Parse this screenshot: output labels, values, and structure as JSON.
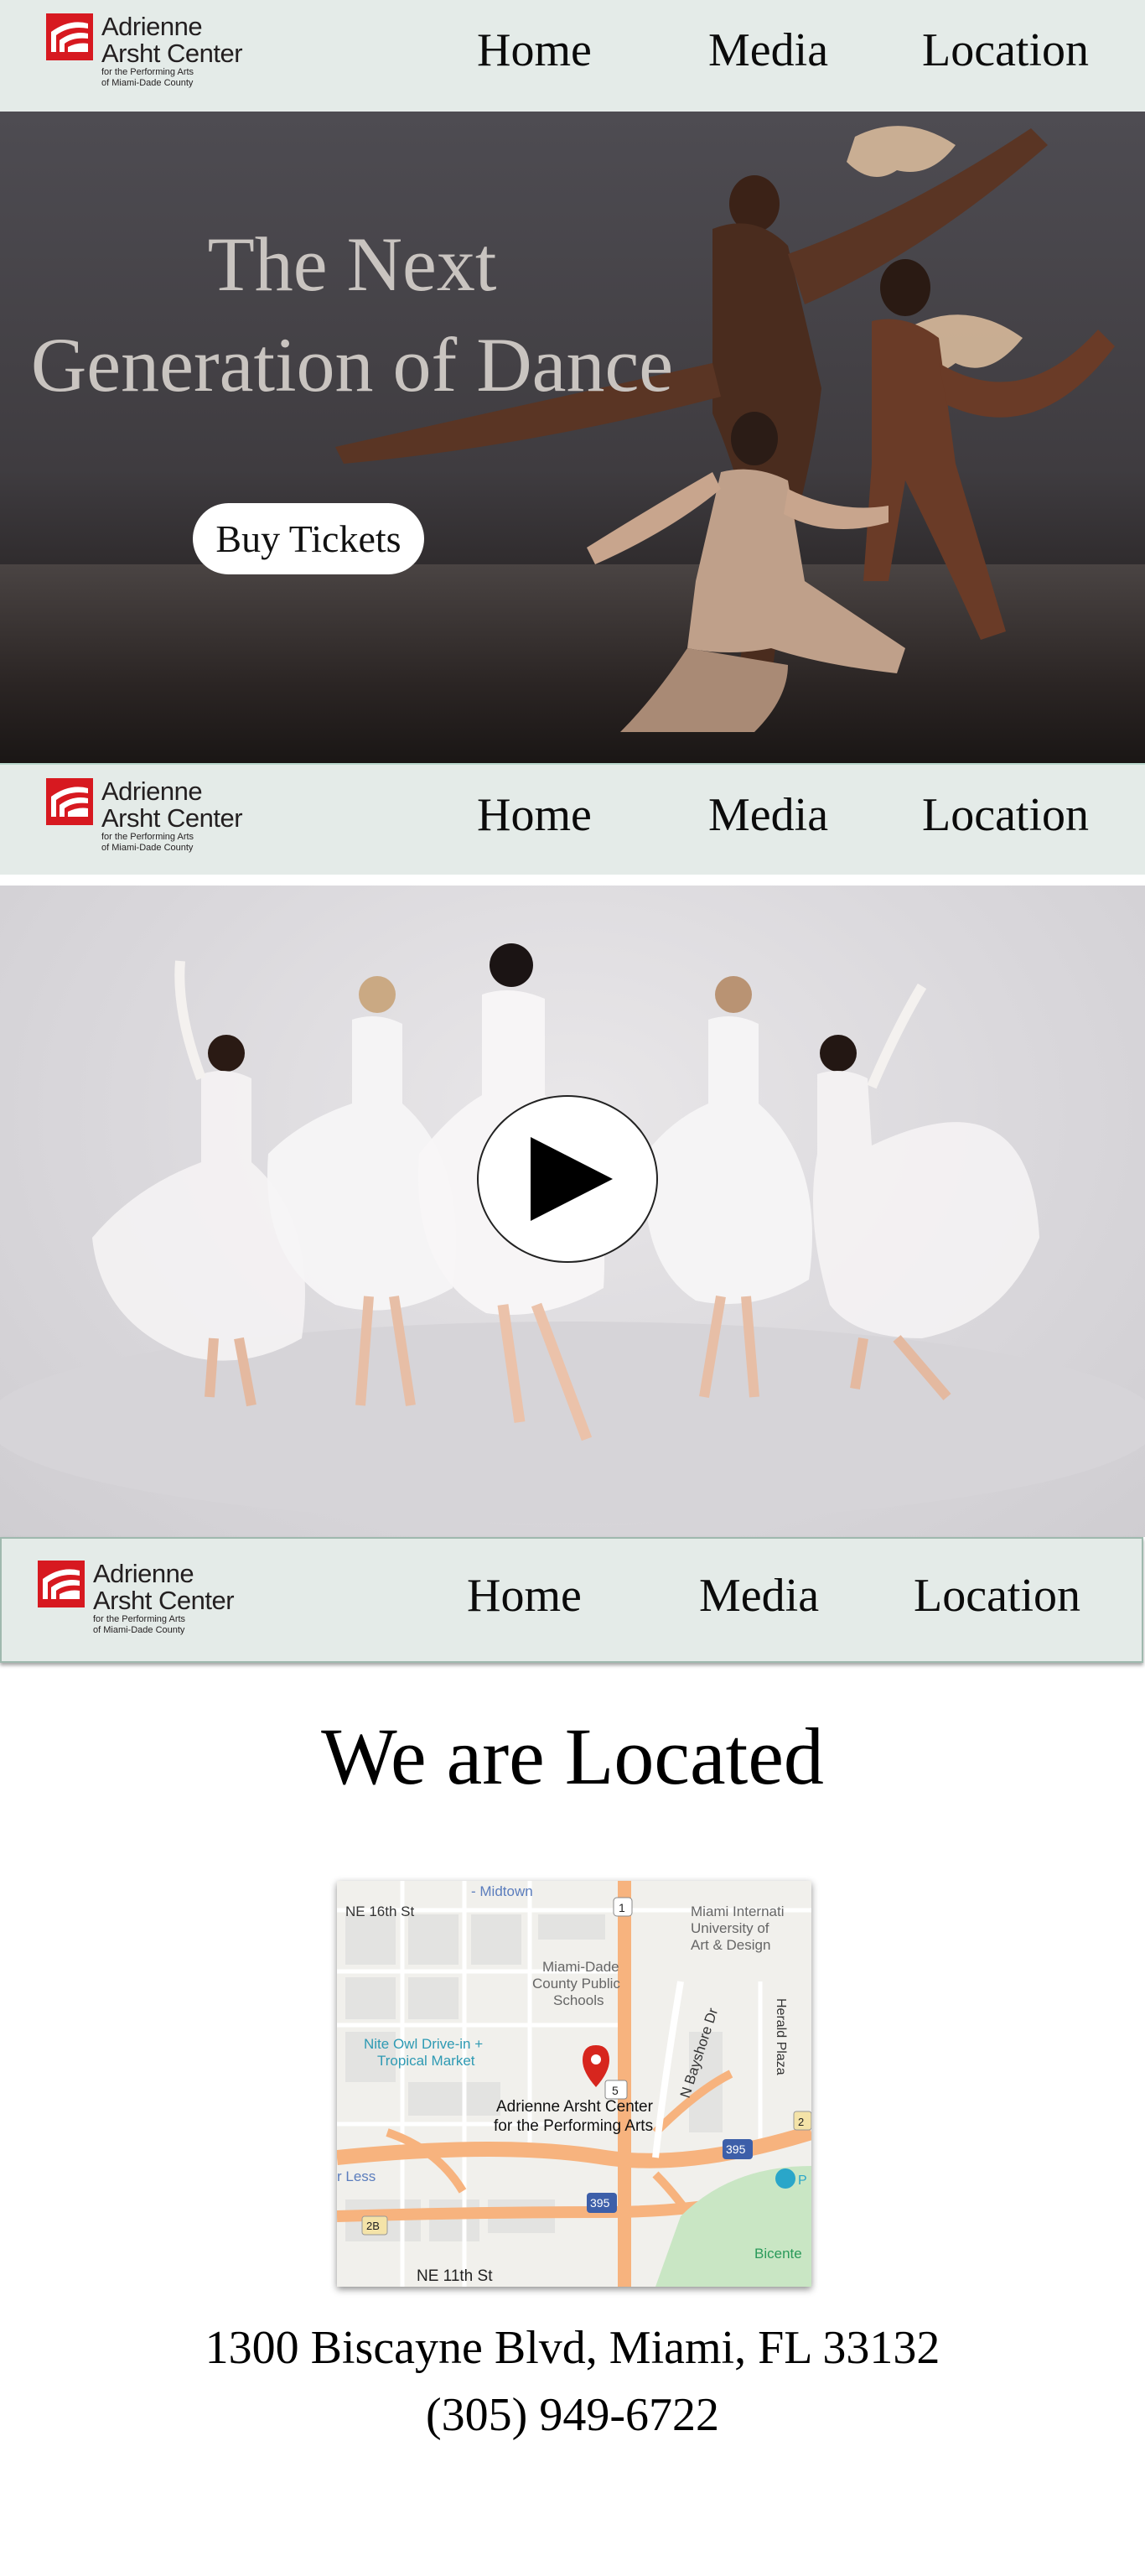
{
  "brand": {
    "line1": "Adrienne",
    "line2": "Arsht Center",
    "line3": "for the Performing Arts",
    "line4": "of Miami-Dade County",
    "color": "#d71920"
  },
  "nav": {
    "home": "Home",
    "media": "Media",
    "location": "Location"
  },
  "hero": {
    "title_line1": "The Next",
    "title_line2": "Generation of Dance",
    "cta": "Buy Tickets"
  },
  "video": {
    "play_icon": "play-icon"
  },
  "location": {
    "heading": "We are Located",
    "address": "1300 Biscayne Blvd, Miami, FL 33132",
    "phone": "(305) 949-6722",
    "map": {
      "venue_line1": "Adrienne Arsht Center",
      "venue_line2": "for the Performing Arts",
      "labels": {
        "midtown": "- Midtown",
        "ne16": "NE 16th St",
        "ne11": "NE 11th St",
        "school1": "Miami-Dade",
        "school2": "County Public",
        "school3": "Schools",
        "miu1": "Miami Internati",
        "miu2": "University of",
        "miu3": "Art & Design",
        "owl1": "Nite Owl Drive-in +",
        "owl2": "Tropical Market",
        "bayshore": "N Bayshore Dr",
        "herald": "Herald Plaza",
        "less": "r Less",
        "bicente": "Bicente",
        "r1": "1",
        "r5": "5",
        "r395a": "395",
        "r395b": "395",
        "r2b": "2B",
        "r2": "2",
        "p": "P"
      }
    }
  }
}
